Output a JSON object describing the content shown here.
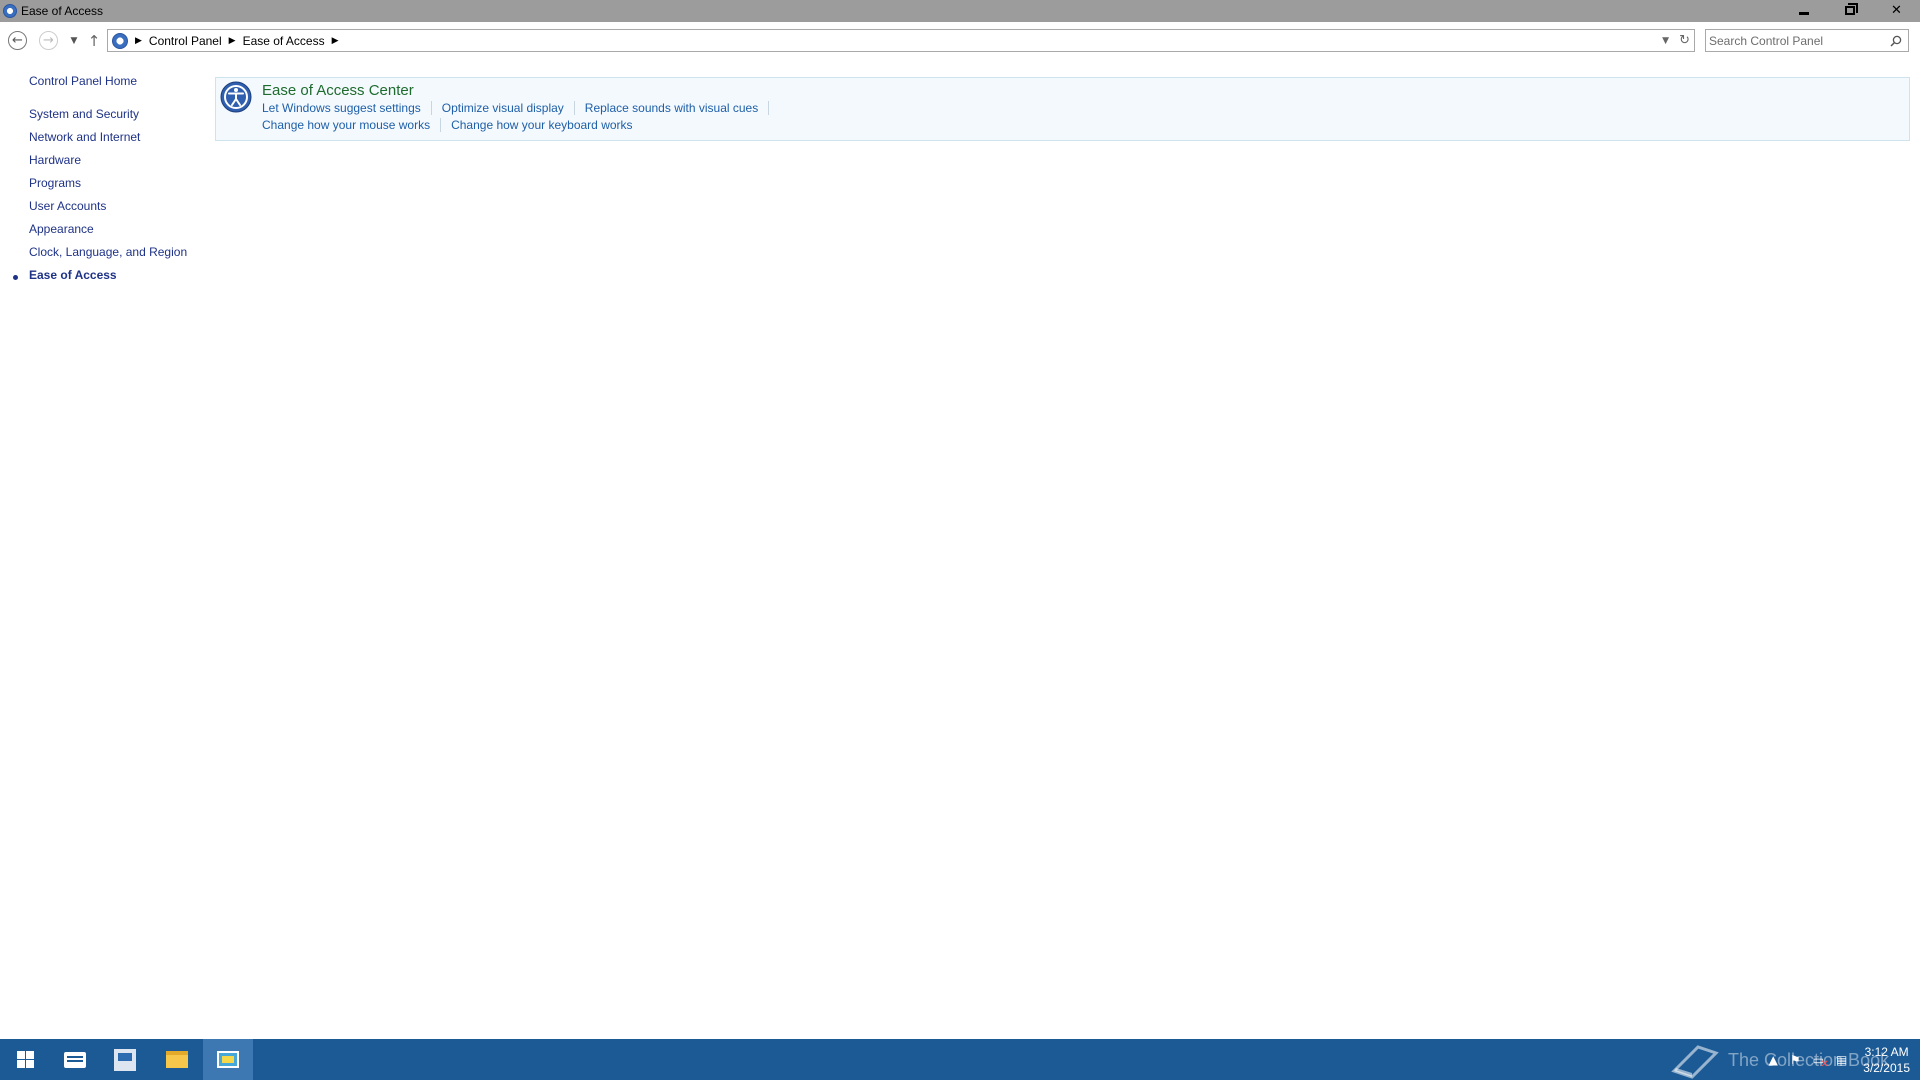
{
  "window": {
    "title": "Ease of Access"
  },
  "address": {
    "crumbs": [
      "Control Panel",
      "Ease of Access"
    ]
  },
  "search": {
    "placeholder": "Search Control Panel"
  },
  "leftnav": {
    "items": [
      {
        "label": "Control Panel Home"
      },
      {
        "label": "System and Security"
      },
      {
        "label": "Network and Internet"
      },
      {
        "label": "Hardware"
      },
      {
        "label": "Programs"
      },
      {
        "label": "User Accounts"
      },
      {
        "label": "Appearance"
      },
      {
        "label": "Clock, Language, and Region"
      },
      {
        "label": "Ease of Access",
        "active": true
      }
    ]
  },
  "category": {
    "title": "Ease of Access Center",
    "icon": "ease-of-access-icon",
    "tasks_row1": [
      "Let Windows suggest settings",
      "Optimize visual display",
      "Replace sounds with visual cues"
    ],
    "tasks_row2": [
      "Change how your mouse works",
      "Change how your keyboard works"
    ]
  },
  "taskbar": {
    "apps": [
      "start-icon",
      "server-manager-icon",
      "powershell-icon",
      "file-explorer-icon",
      "control-panel-icon"
    ],
    "watermark": "The Collection Book",
    "time": "3:12 AM",
    "date": "3/2/2015"
  },
  "colors": {
    "titlebar": "#9c9c9c",
    "link": "#1e3287",
    "task_link": "#1e5fa8",
    "category_title": "#1e6b2e",
    "taskbar": "#1c5a96"
  }
}
